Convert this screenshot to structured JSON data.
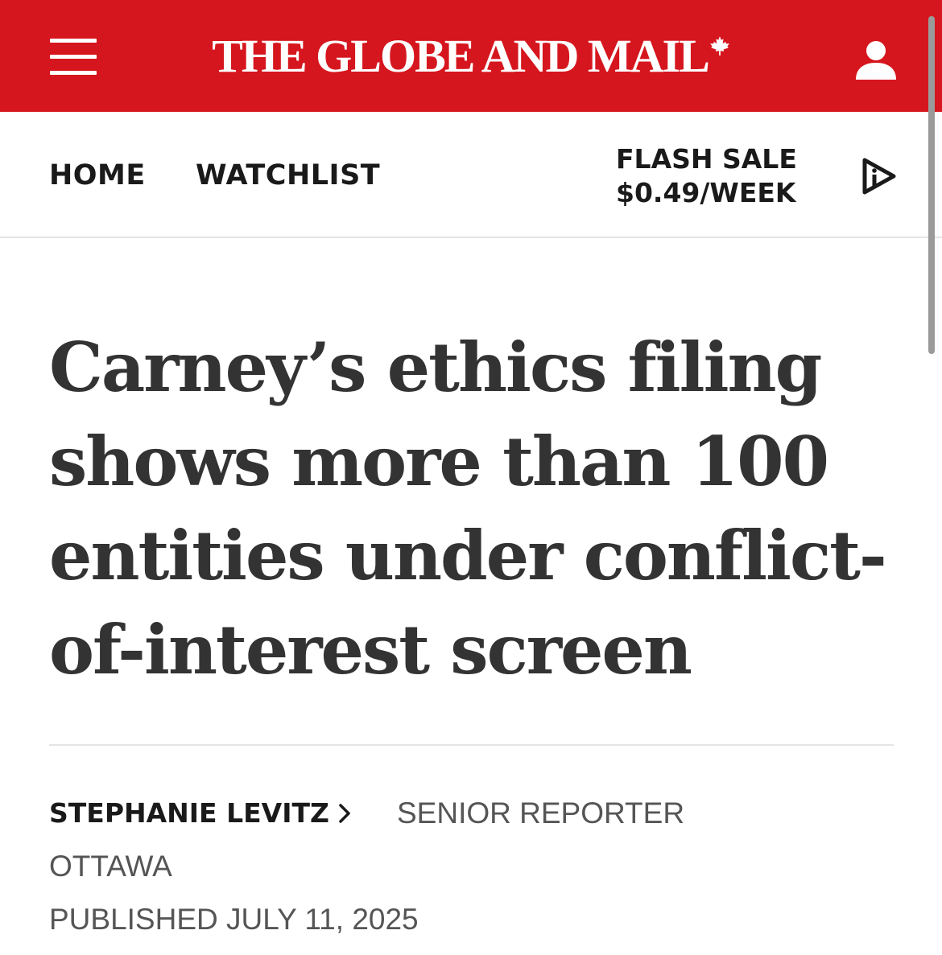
{
  "header": {
    "logo_text": "THE GLOBE AND MAIL",
    "brand_color": "#d6161e",
    "menu_icon": "hamburger-menu-icon",
    "account_icon": "user-account-icon",
    "logo_icon": "maple-leaf-icon"
  },
  "nav": {
    "home": "HOME",
    "watchlist": "WATCHLIST",
    "promo_line1": "FLASH SALE",
    "promo_line2": "$0.49/WEEK",
    "play_icon": "play-info-icon"
  },
  "article": {
    "headline": "Carney’s ethics filing shows more than 100 entities under conflict-of-interest screen",
    "author": "STEPHANIE LEVITZ",
    "author_icon": "chevron-right-icon",
    "role": "SENIOR REPORTER",
    "location": "OTTAWA",
    "published": "PUBLISHED JULY 11, 2025"
  }
}
